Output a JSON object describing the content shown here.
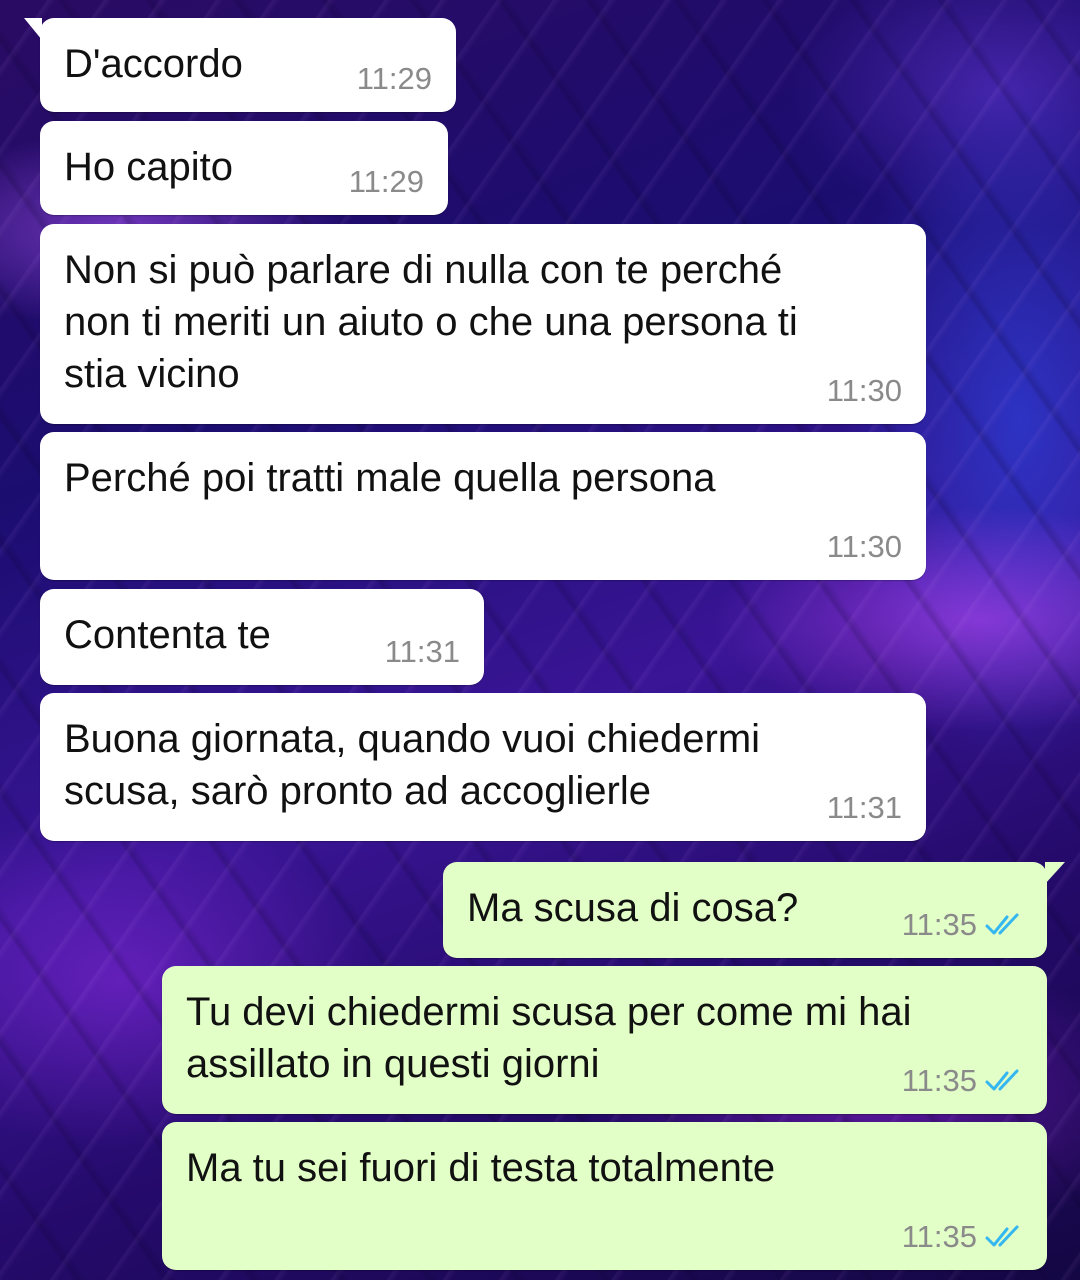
{
  "colors": {
    "incoming_bubble": "#ffffff",
    "outgoing_bubble": "#e2ffc7",
    "timestamp": "#8a8a8a",
    "read_ticks": "#34b7f1"
  },
  "messages": [
    {
      "direction": "incoming",
      "text": "D'accordo",
      "time": "11:29"
    },
    {
      "direction": "incoming",
      "text": "Ho capito",
      "time": "11:29"
    },
    {
      "direction": "incoming",
      "text": "Non si può parlare di nulla con te perché\nnon ti meriti un aiuto o che una persona ti\nstia vicino",
      "time": "11:30"
    },
    {
      "direction": "incoming",
      "text": "Perché poi tratti male quella persona",
      "time": "11:30"
    },
    {
      "direction": "incoming",
      "text": "Contenta te",
      "time": "11:31"
    },
    {
      "direction": "incoming",
      "text": "Buona giornata, quando vuoi chiedermi\nscusa, sarò pronto ad accoglierle",
      "time": "11:31"
    },
    {
      "direction": "outgoing",
      "text": "Ma scusa di cosa?",
      "time": "11:35",
      "status_icon": "double-check-read-icon"
    },
    {
      "direction": "outgoing",
      "text": "Tu devi chiedermi scusa per come mi hai\nassillato in questi giorni",
      "time": "11:35",
      "status_icon": "double-check-read-icon"
    },
    {
      "direction": "outgoing",
      "text": "Ma tu sei fuori di testa totalmente",
      "time": "11:35",
      "status_icon": "double-check-read-icon"
    }
  ]
}
